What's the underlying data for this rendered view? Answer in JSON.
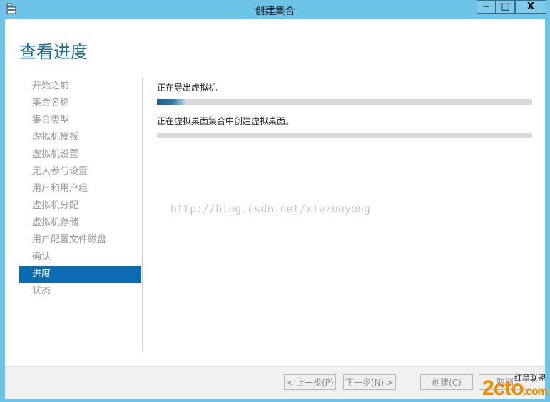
{
  "window": {
    "title": "创建集合",
    "controls": {
      "minimize": "−",
      "maximize": "□",
      "close": "X"
    }
  },
  "page": {
    "heading": "查看进度"
  },
  "nav": {
    "items": [
      {
        "label": "开始之前",
        "active": false
      },
      {
        "label": "集合名称",
        "active": false
      },
      {
        "label": "集合类型",
        "active": false
      },
      {
        "label": "虚拟机模板",
        "active": false
      },
      {
        "label": "虚拟机设置",
        "active": false
      },
      {
        "label": "无人参与设置",
        "active": false
      },
      {
        "label": "用户和用户组",
        "active": false
      },
      {
        "label": "虚拟机分配",
        "active": false
      },
      {
        "label": "虚拟机存储",
        "active": false
      },
      {
        "label": "用户配置文件磁盘",
        "active": false
      },
      {
        "label": "确认",
        "active": false
      },
      {
        "label": "进度",
        "active": true
      },
      {
        "label": "状态",
        "active": false
      }
    ]
  },
  "tasks": [
    {
      "label": "正在导出虚拟机",
      "progress": 0.08
    },
    {
      "label": "正在虚拟桌面集合中创建虚拟桌面。",
      "progress": 0
    }
  ],
  "watermark": "http://blog.csdn.net/xiezuoyong",
  "footer": {
    "prev": "< 上一步(P)",
    "next": "下一步(N) >",
    "create": "创建(C)",
    "cancel": "取消"
  },
  "logo": {
    "brand": "红黑联盟",
    "main": "2cto",
    "suffix": ".com"
  },
  "colors": {
    "accent": "#0b6bb3",
    "heading": "#1b6f99",
    "titlebar": "#6ec3e8"
  }
}
